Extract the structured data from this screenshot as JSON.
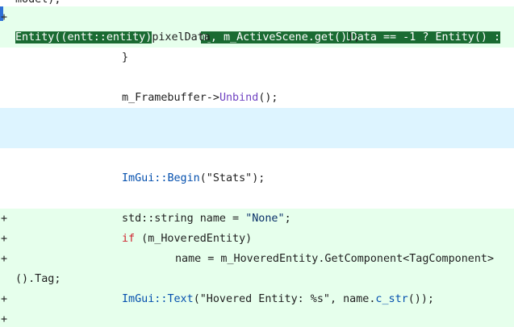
{
  "diff": {
    "lines": [
      {
        "id": "l0",
        "marker": "",
        "text": "model);"
      },
      {
        "id": "l1",
        "marker": "+",
        "seg": [
          "m_HoveredEntity = pixelData == -1 ? Entity() :"
        ]
      },
      {
        "id": "l2",
        "marker": "",
        "seg": [
          "Entity((entt::entity)",
          "pixelData",
          ", m_ActiveScene.get()",
          ");"
        ]
      },
      {
        "id": "l3",
        "marker": "",
        "text": "}"
      },
      {
        "id": "l4",
        "marker": "",
        "seg": [
          "m_Framebuffer->",
          "Unbind",
          "();"
        ]
      },
      {
        "id": "l5",
        "marker": "",
        "seg": [
          "ImGui::",
          "Begin",
          "(\"Stats\");"
        ]
      },
      {
        "id": "l6",
        "marker": "+",
        "seg": [
          "std::string name = ",
          "\"None\"",
          ";"
        ]
      },
      {
        "id": "l7",
        "marker": "+",
        "seg": [
          "if",
          " (m_HoveredEntity)"
        ]
      },
      {
        "id": "l8",
        "marker": "+",
        "seg": [
          "name = m_HoveredEntity.GetComponent<TagComponent>"
        ]
      },
      {
        "id": "l9",
        "marker": "",
        "text": "().Tag;"
      },
      {
        "id": "l10",
        "marker": "+",
        "seg": [
          "ImGui::",
          "Text",
          "(\"Hovered Entity: %s\", name.",
          "c_str",
          "());"
        ]
      },
      {
        "id": "l11",
        "marker": "+",
        "text": ""
      }
    ]
  },
  "colors": {
    "added_bg": "#e6ffec",
    "highlight_bg": "#1a6b32",
    "info_bg": "#ddf4ff",
    "cursor": "#2f6fd6"
  }
}
